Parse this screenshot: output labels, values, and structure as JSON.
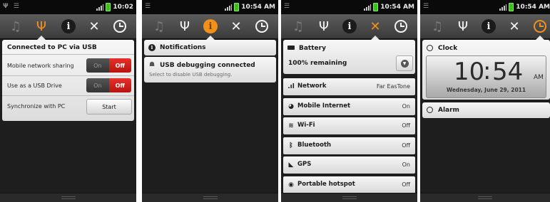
{
  "panels": [
    {
      "status": {
        "left_icons": "Ψ ☰",
        "time": "10:02"
      },
      "usb": {
        "title": "Connected to PC via USB",
        "rows": [
          {
            "label": "Mobile network sharing",
            "on": "On",
            "off": "Off"
          },
          {
            "label": "Use as a USB Drive",
            "on": "On",
            "off": "Off"
          }
        ],
        "sync_label": "Synchronize with PC",
        "start": "Start"
      }
    },
    {
      "status": {
        "left_icons": "☰",
        "time": "10:54 AM"
      },
      "notifications": {
        "header": "Notifications",
        "title": "USB debugging connected",
        "subtitle": "Select to disable USB debugging."
      }
    },
    {
      "status": {
        "left_icons": "☰",
        "time": "10:54 AM"
      },
      "battery": {
        "label": "Battery",
        "value": "100% remaining"
      },
      "settings": [
        {
          "icon": "signal-icon",
          "name": "Network",
          "value": "Far EasTone"
        },
        {
          "icon": "mobile-internet-icon",
          "name": "Mobile Internet",
          "value": "On"
        },
        {
          "icon": "wifi-icon",
          "name": "Wi-Fi",
          "value": "Off"
        },
        {
          "icon": "bluetooth-icon",
          "name": "Bluetooth",
          "value": "Off"
        },
        {
          "icon": "gps-icon",
          "name": "GPS",
          "value": "On"
        },
        {
          "icon": "hotspot-icon",
          "name": "Portable hotspot",
          "value": "Off"
        }
      ]
    },
    {
      "status": {
        "left_icons": "☰",
        "time": "10:54 AM"
      },
      "clock": {
        "label": "Clock",
        "hour": "10",
        "minute": "54",
        "ampm": "AM",
        "date": "Wednesday, June 29, 2011"
      },
      "alarm": {
        "label": "Alarm"
      }
    }
  ],
  "colors": {
    "accent": "#f1911a",
    "off_red": "#d21f19",
    "battery_green": "#39c21b"
  }
}
